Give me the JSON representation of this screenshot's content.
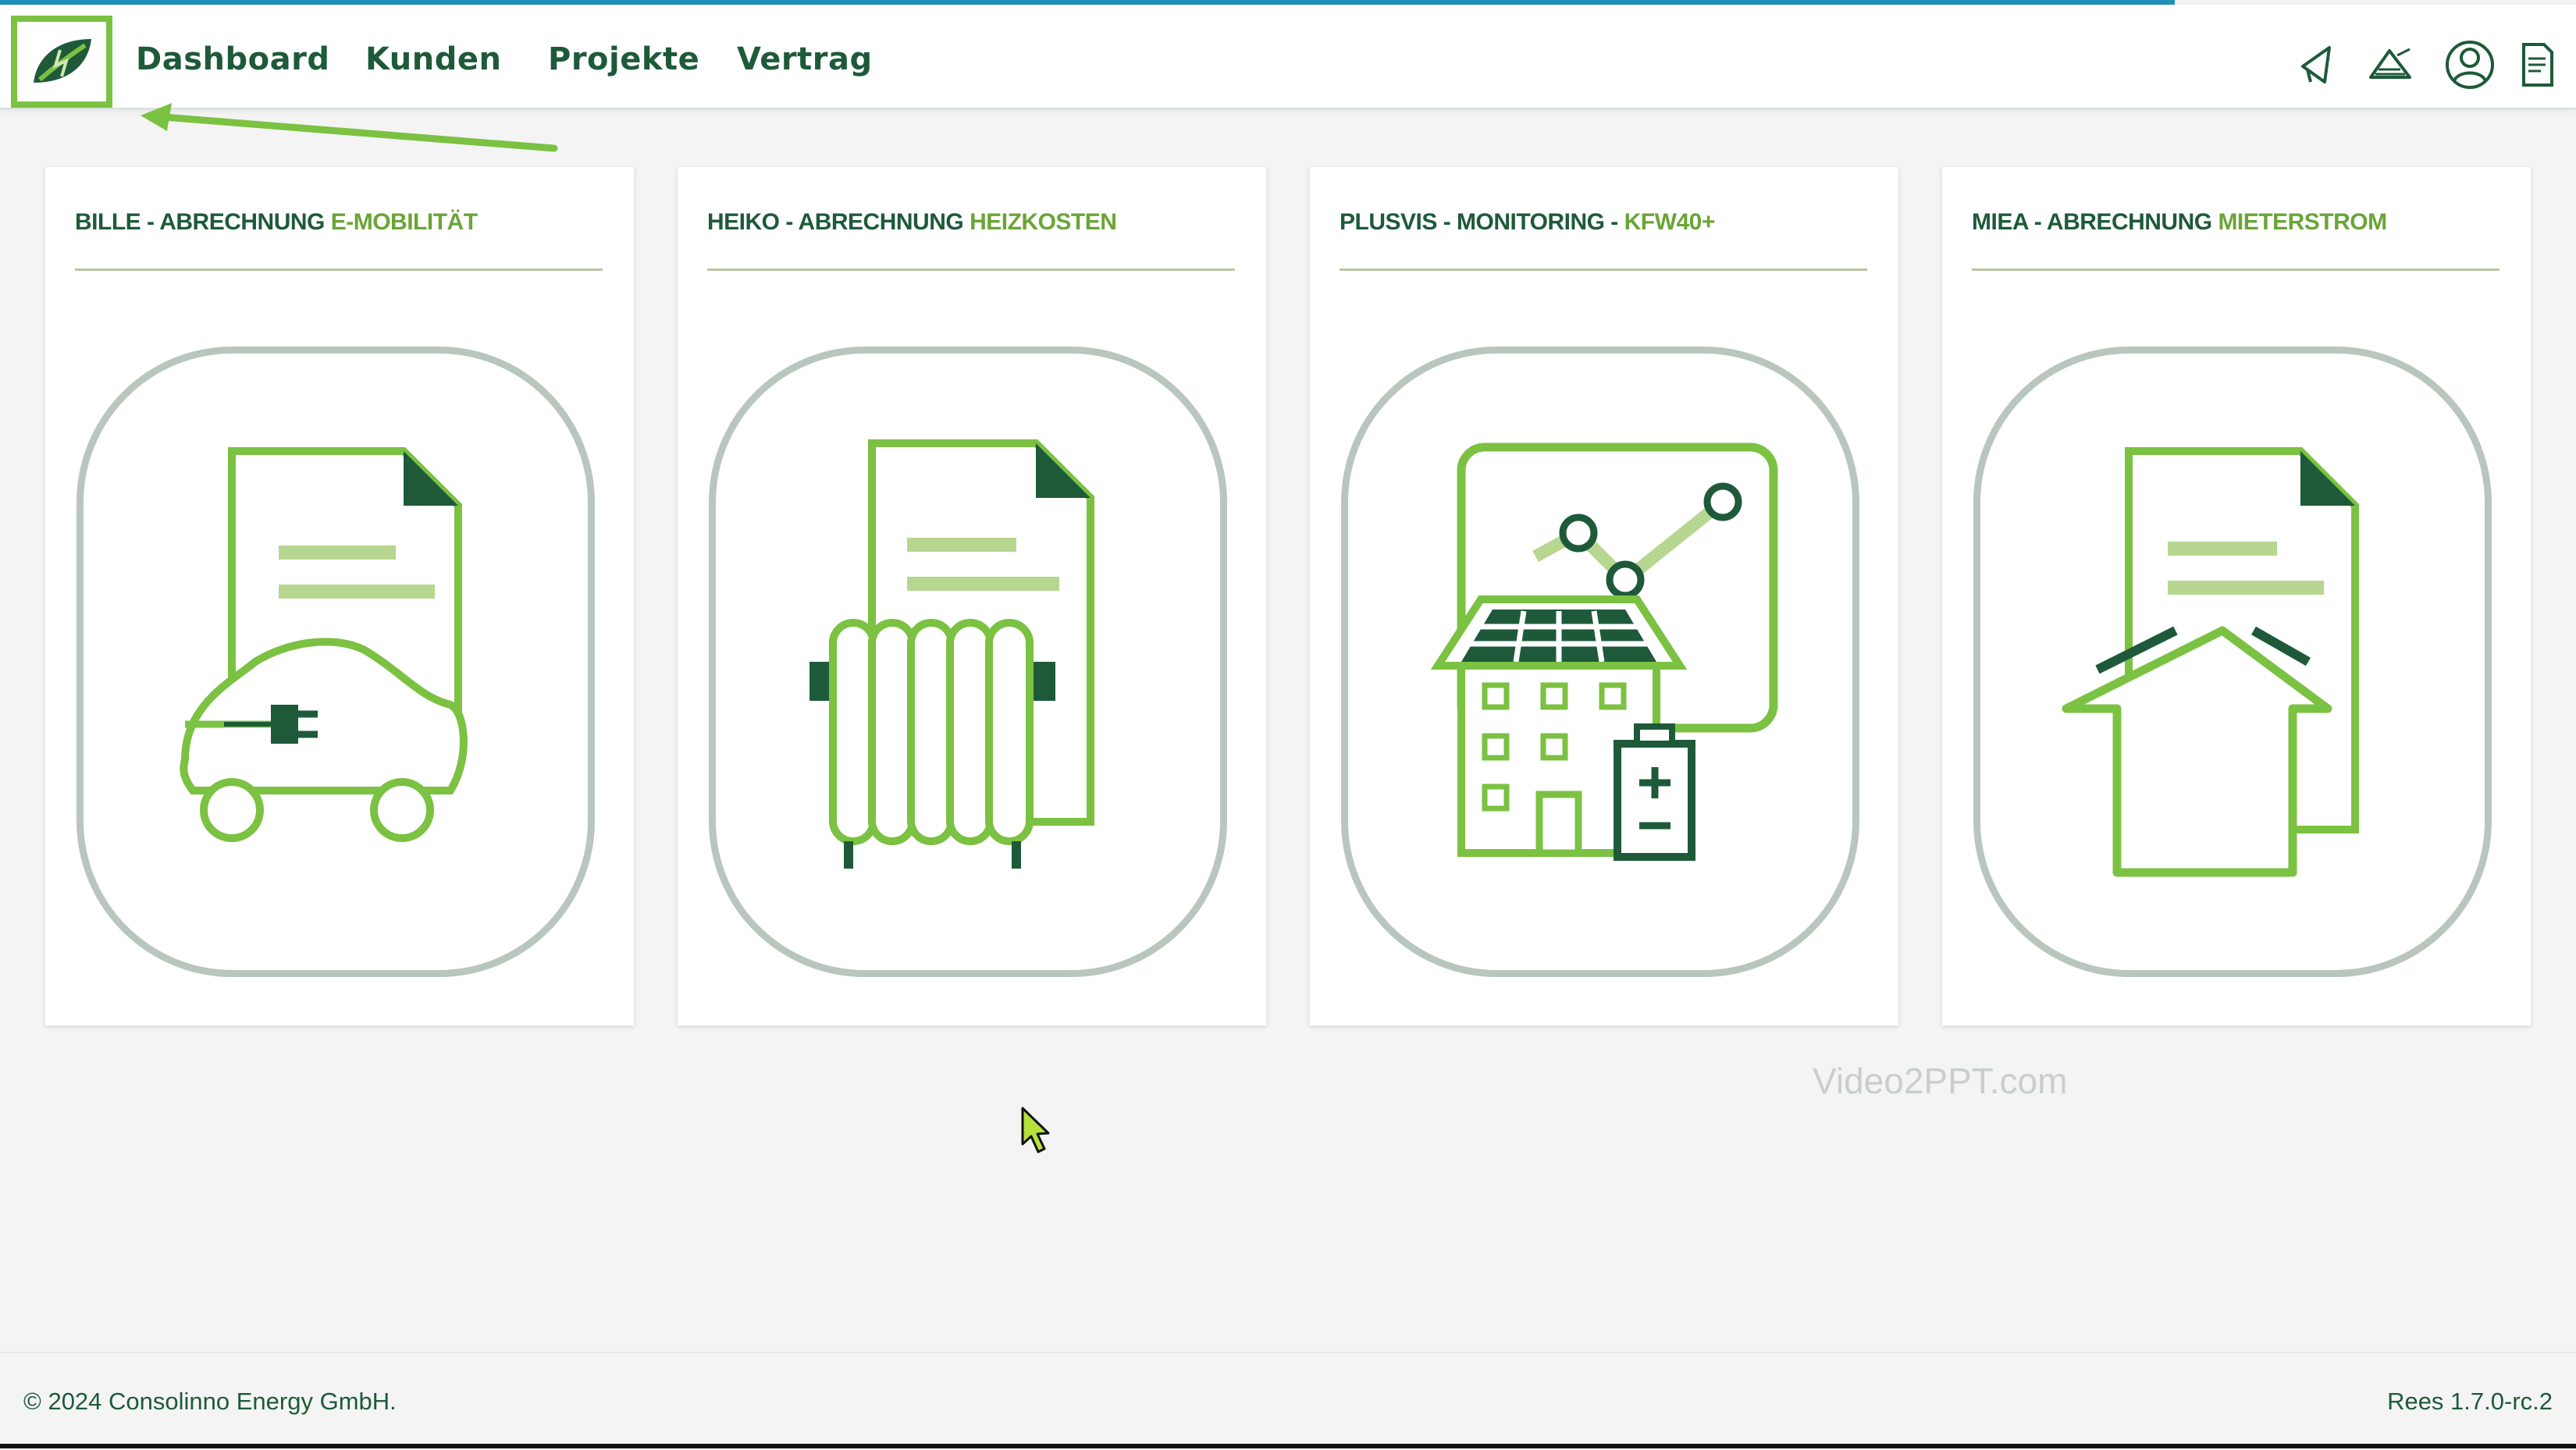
{
  "header": {
    "nav": [
      {
        "label": "Dashboard"
      },
      {
        "label": "Kunden"
      },
      {
        "label": "Projekte"
      },
      {
        "label": "Vertrag"
      }
    ],
    "icons": [
      "megaphone-icon",
      "broadcast-icon",
      "user-profile-icon",
      "document-icon"
    ]
  },
  "cards": [
    {
      "title_prefix": "BILLE - ABRECHNUNG ",
      "title_highlight": "E-MOBILITÄT",
      "icon": "ev-car-document-icon"
    },
    {
      "title_prefix": "HEIKO - ABRECHNUNG ",
      "title_highlight": "HEIZKOSTEN",
      "icon": "radiator-document-icon"
    },
    {
      "title_prefix": "PLUSVIS - MONITORING - ",
      "title_highlight": "KFW40+",
      "icon": "solar-house-monitoring-icon"
    },
    {
      "title_prefix": "MIEA - ABRECHNUNG ",
      "title_highlight": "MIETERSTROM",
      "icon": "house-document-icon"
    }
  ],
  "watermark": "Video2PPT.com",
  "footer": {
    "copyright": "© 2024 Consolinno Energy GmbH.",
    "version": "Rees 1.7.0-rc.2"
  },
  "colors": {
    "brand_dark": "#1e5a3a",
    "brand_green": "#7bc142",
    "accent_blue": "#1f8eb8"
  }
}
